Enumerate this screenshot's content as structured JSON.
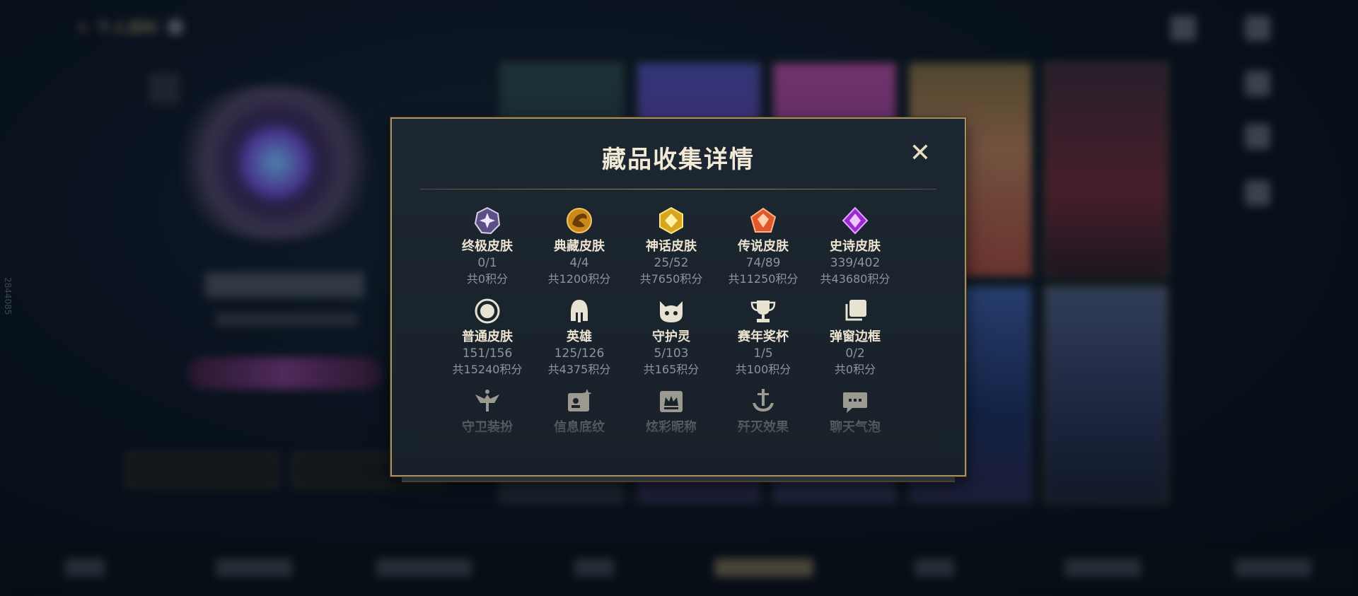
{
  "background": {
    "header": {
      "title": "个人资料"
    },
    "side_id": "2844085"
  },
  "dialog": {
    "title": "藏品收集详情",
    "close_icon": "close-x-icon",
    "categories": [
      {
        "icon": "ultimate-skin-icon",
        "name": "终极皮肤",
        "count": "0/1",
        "points": "共0积分"
      },
      {
        "icon": "collection-skin-icon",
        "name": "典藏皮肤",
        "count": "4/4",
        "points": "共1200积分"
      },
      {
        "icon": "mythic-skin-icon",
        "name": "神话皮肤",
        "count": "25/52",
        "points": "共7650积分"
      },
      {
        "icon": "legendary-skin-icon",
        "name": "传说皮肤",
        "count": "74/89",
        "points": "共11250积分"
      },
      {
        "icon": "epic-skin-icon",
        "name": "史诗皮肤",
        "count": "339/402",
        "points": "共43680积分"
      },
      {
        "icon": "normal-skin-icon",
        "name": "普通皮肤",
        "count": "151/156",
        "points": "共15240积分"
      },
      {
        "icon": "helmet-hero-icon",
        "name": "英雄",
        "count": "125/126",
        "points": "共4375积分"
      },
      {
        "icon": "guardian-spirit-icon",
        "name": "守护灵",
        "count": "5/103",
        "points": "共165积分"
      },
      {
        "icon": "trophy-icon",
        "name": "赛年奖杯",
        "count": "1/5",
        "points": "共100积分"
      },
      {
        "icon": "popup-frame-icon",
        "name": "弹窗边框",
        "count": "0/2",
        "points": "共0积分"
      },
      {
        "icon": "guardian-outfit-icon",
        "name": "守卫装扮"
      },
      {
        "icon": "info-background-icon",
        "name": "信息底纹"
      },
      {
        "icon": "colorful-nickname-icon",
        "name": "炫彩昵称"
      },
      {
        "icon": "kill-effect-icon",
        "name": "歼灭效果"
      },
      {
        "icon": "chat-bubble-icon",
        "name": "聊天气泡"
      }
    ]
  }
}
